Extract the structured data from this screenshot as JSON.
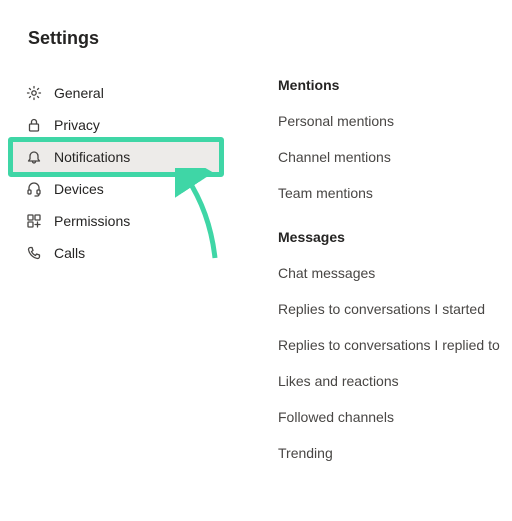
{
  "title": "Settings",
  "sidebar": {
    "items": [
      {
        "label": "General"
      },
      {
        "label": "Privacy"
      },
      {
        "label": "Notifications"
      },
      {
        "label": "Devices"
      },
      {
        "label": "Permissions"
      },
      {
        "label": "Calls"
      }
    ]
  },
  "sections": [
    {
      "heading": "Mentions",
      "options": [
        "Personal mentions",
        "Channel mentions",
        "Team mentions"
      ]
    },
    {
      "heading": "Messages",
      "options": [
        "Chat messages",
        "Replies to conversations I started",
        "Replies to conversations I replied to",
        "Likes and reactions",
        "Followed channels",
        "Trending"
      ]
    }
  ]
}
